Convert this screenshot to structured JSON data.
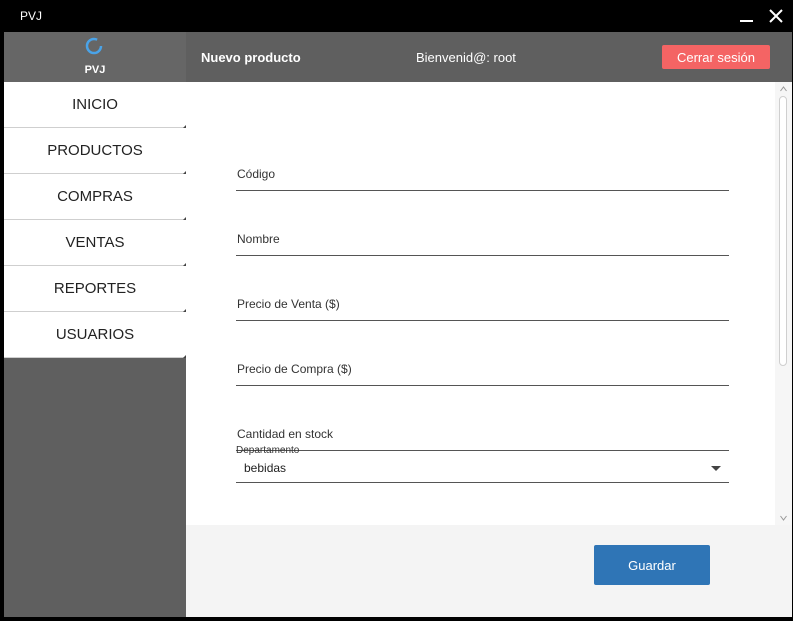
{
  "window": {
    "title": "PVJ"
  },
  "brand": {
    "name": "PVJ",
    "logo_icon": "spinner-ring-icon",
    "logo_color": "#4aa3e8"
  },
  "header": {
    "section_title": "Nuevo producto",
    "welcome": "Bienvenid@: root",
    "logout_label": "Cerrar sesión",
    "logout_color": "#f46464"
  },
  "sidebar": {
    "items": [
      {
        "label": "INICIO"
      },
      {
        "label": "PRODUCTOS"
      },
      {
        "label": "COMPRAS"
      },
      {
        "label": "VENTAS"
      },
      {
        "label": "REPORTES"
      },
      {
        "label": "USUARIOS"
      }
    ]
  },
  "form": {
    "fields": [
      {
        "placeholder": "Código",
        "value": ""
      },
      {
        "placeholder": "Nombre",
        "value": ""
      },
      {
        "placeholder": "Precio de Venta ($)",
        "value": ""
      },
      {
        "placeholder": "Precio de Compra ($)",
        "value": ""
      },
      {
        "placeholder": "Cantidad en stock",
        "value": ""
      }
    ],
    "department": {
      "label": "Departamento",
      "value": "bebidas"
    },
    "save_label": "Guardar",
    "save_color": "#2f75b6"
  }
}
